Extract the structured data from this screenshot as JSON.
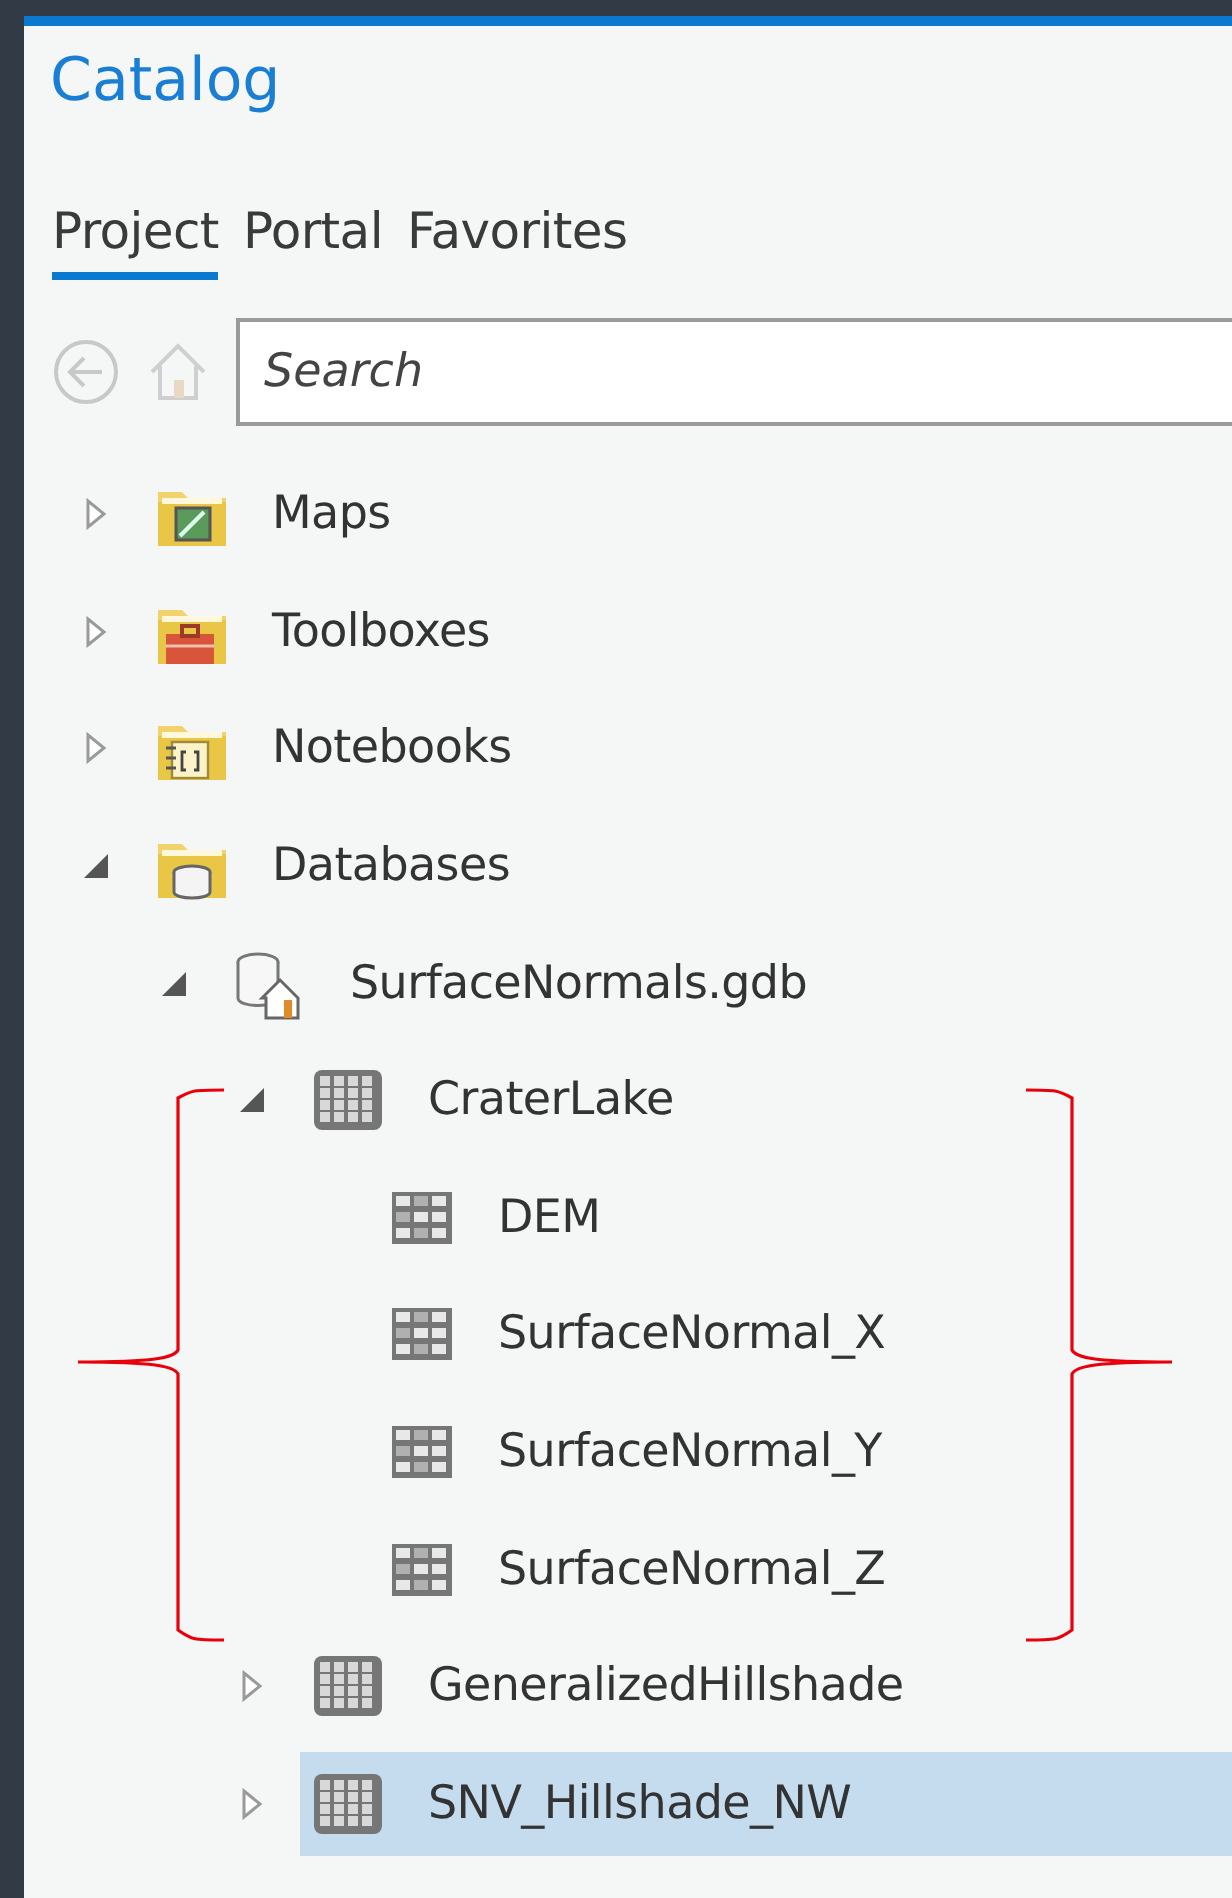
{
  "panel": {
    "title": "Catalog"
  },
  "tabs": [
    {
      "label": "Project",
      "selected": true
    },
    {
      "label": "Portal",
      "selected": false
    },
    {
      "label": "Favorites",
      "selected": false
    }
  ],
  "search": {
    "placeholder": "Search"
  },
  "tree": [
    {
      "label": "Maps",
      "kind": "maps-folder",
      "expanded": false,
      "selected": false
    },
    {
      "label": "Toolboxes",
      "kind": "toolbox-folder",
      "expanded": false,
      "selected": false
    },
    {
      "label": "Notebooks",
      "kind": "notebook-folder",
      "expanded": false,
      "selected": false
    },
    {
      "label": "Databases",
      "kind": "database-folder",
      "expanded": true,
      "selected": false,
      "children": [
        {
          "label": "SurfaceNormals.gdb",
          "kind": "geodatabase",
          "expanded": true,
          "selected": false,
          "children": [
            {
              "label": "CraterLake",
              "kind": "raster-dataset",
              "expanded": true,
              "selected": false,
              "children": [
                {
                  "label": "DEM",
                  "kind": "raster",
                  "selected": false
                },
                {
                  "label": "SurfaceNormal_X",
                  "kind": "raster",
                  "selected": false
                },
                {
                  "label": "SurfaceNormal_Y",
                  "kind": "raster",
                  "selected": false
                },
                {
                  "label": "SurfaceNormal_Z",
                  "kind": "raster",
                  "selected": false
                }
              ]
            },
            {
              "label": "GeneralizedHillshade",
              "kind": "raster-dataset",
              "expanded": false,
              "selected": false
            },
            {
              "label": "SNV_Hillshade_NW",
              "kind": "raster-dataset",
              "expanded": false,
              "selected": true
            }
          ]
        }
      ]
    }
  ]
}
